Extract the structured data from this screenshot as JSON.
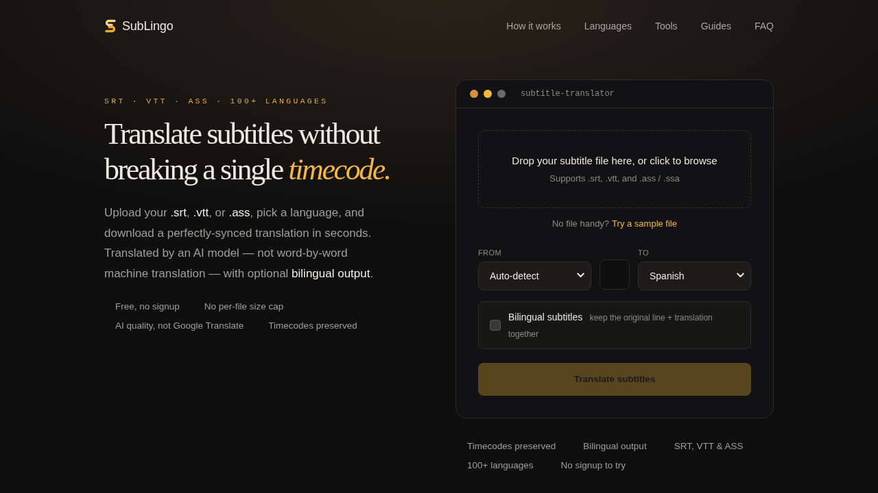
{
  "nav": {
    "brand": "SubLingo",
    "links": [
      "How it works",
      "Languages",
      "Tools",
      "Guides",
      "FAQ"
    ]
  },
  "hero": {
    "eyebrow": "SRT · VTT · ASS · 100+ LANGUAGES",
    "title": "Translate subtitles without breaking a single *timecode.*",
    "lead": "Upload your **.srt**, **.vtt**, or **.ass**, pick a language, and download a perfectly-synced translation in seconds. Translated by an AI model — not word-by-word machine translation — with optional **bilingual output**.",
    "perks": [
      "Free, no signup",
      "No per-file size cap",
      "AI quality, not Google Translate",
      "Timecodes preserved"
    ]
  },
  "translator": {
    "window_dots": [
      {
        "color": "#d4913c"
      },
      {
        "color": "#f4b740"
      },
      {
        "color": "#6b6a66"
      }
    ],
    "window_title": "subtitle-translator",
    "dropzone": {
      "title": "Drop your subtitle file here, or click to browse",
      "hint": "Supports .srt, .vtt, and .ass / .ssa"
    },
    "sample": {
      "prompt": "No file handy?",
      "link": "Try a sample file"
    },
    "from": {
      "label": "FROM",
      "value": "Auto-detect"
    },
    "to": {
      "label": "TO",
      "value": "Spanish"
    },
    "bilingual": {
      "label": "Bilingual subtitles",
      "hint": "keep the original line + translation together",
      "checked": false
    },
    "submit": {
      "label": "Translate subtitles",
      "disabled": true
    }
  },
  "highlights": [
    "Timecodes preserved",
    "Bilingual output",
    "SRT, VTT & ASS",
    "100+ languages",
    "No signup to try"
  ]
}
